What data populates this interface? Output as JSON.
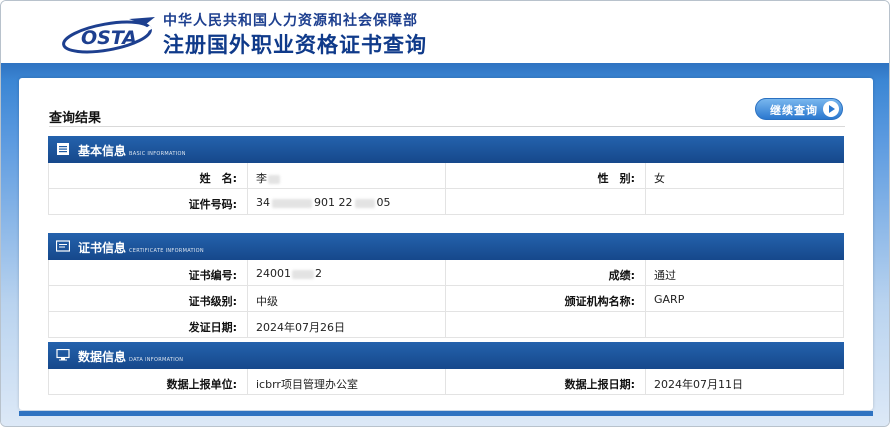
{
  "header": {
    "logo_text": "OSTA",
    "org_name": "中华人民共和国人力资源和社会保障部",
    "site_title": "注册国外职业资格证书查询"
  },
  "result": {
    "title": "查询结果",
    "continue_button": "继续查询"
  },
  "sections": {
    "basic": {
      "title": "基本信息",
      "subtitle": "BASIC INFORMATION",
      "name_label": "姓　名:",
      "name_value": "李",
      "gender_label": "性　别:",
      "gender_value": "女",
      "id_label": "证件号码:",
      "id_value_prefix": "34",
      "id_value_mid": "901 22",
      "id_value_suffix": "05"
    },
    "certificate": {
      "title": "证书信息",
      "subtitle": "CERTIFICATE INFORMATION",
      "cert_no_label": "证书编号:",
      "cert_no_prefix": "24001",
      "cert_no_suffix": "2",
      "score_label": "成绩:",
      "score_value": "通过",
      "level_label": "证书级别:",
      "level_value": "中级",
      "issuer_label": "颁证机构名称:",
      "issuer_value": "GARP",
      "issue_date_label": "发证日期:",
      "issue_date_value": "2024年07月26日"
    },
    "data": {
      "title": "数据信息",
      "subtitle": "DATA INFORMATION",
      "reporter_label": "数据上报单位:",
      "reporter_value": "icbrr项目管理办公室",
      "report_date_label": "数据上报日期:",
      "report_date_value": "2024年07月11日"
    }
  },
  "colors": {
    "brand_blue": "#1d3f8f",
    "section_bar": "#1d5aa3",
    "band_blue": "#3b86d4"
  }
}
